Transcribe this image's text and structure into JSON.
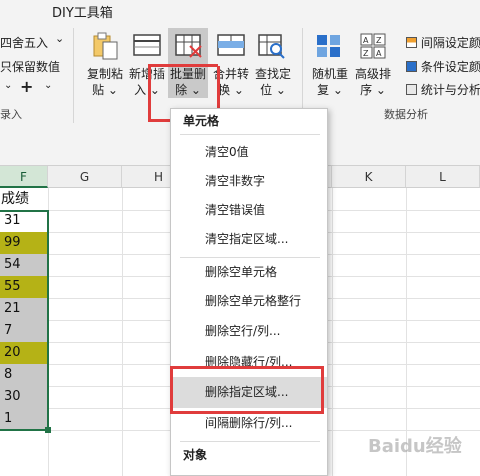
{
  "ribbon": {
    "tab_title": "DIY工具箱",
    "left_items": {
      "round": "四舍五入",
      "round_arrow": "⌄",
      "keep_value": "只保留数值",
      "plus": "+",
      "group_label": "录入"
    },
    "buttons": [
      {
        "id": "copy-paste",
        "line1": "复制粘",
        "line2": "贴 ⌄"
      },
      {
        "id": "insert",
        "line1": "新增插",
        "line2": "入 ⌄"
      },
      {
        "id": "batch-delete",
        "line1": "批量删",
        "line2": "除 ⌄"
      },
      {
        "id": "merge-convert",
        "line1": "合并转",
        "line2": "换 ⌄"
      },
      {
        "id": "find-locate",
        "line1": "查找定",
        "line2": "位 ⌄"
      },
      {
        "id": "random-repeat",
        "line1": "随机重",
        "line2": "复 ⌄"
      },
      {
        "id": "advanced-sort",
        "line1": "高级排",
        "line2": "序 ⌄"
      }
    ],
    "right_items": [
      {
        "label": "间隔设定颜"
      },
      {
        "label": "条件设定颜"
      },
      {
        "label": "统计与分析"
      }
    ],
    "group_label_analysis": "数据分析"
  },
  "grid": {
    "columns": [
      "F",
      "G",
      "H",
      "K",
      "L"
    ],
    "header_cell": "成绩",
    "values": [
      "31",
      "99",
      "54",
      "55",
      "21",
      "7",
      "20",
      "8",
      "30",
      "1"
    ],
    "highlighted_rows": [
      1,
      3,
      6
    ]
  },
  "menu": {
    "section1": "单元格",
    "items": [
      "清空0值",
      "清空非数字",
      "清空错误值",
      "清空指定区域...",
      "删除空单元格",
      "删除空单元格整行",
      "删除空行/列...",
      "删除隐藏行/列...",
      "删除指定区域...",
      "间隔删除行/列..."
    ],
    "section2": "对象"
  },
  "watermark": "Baidu经验"
}
